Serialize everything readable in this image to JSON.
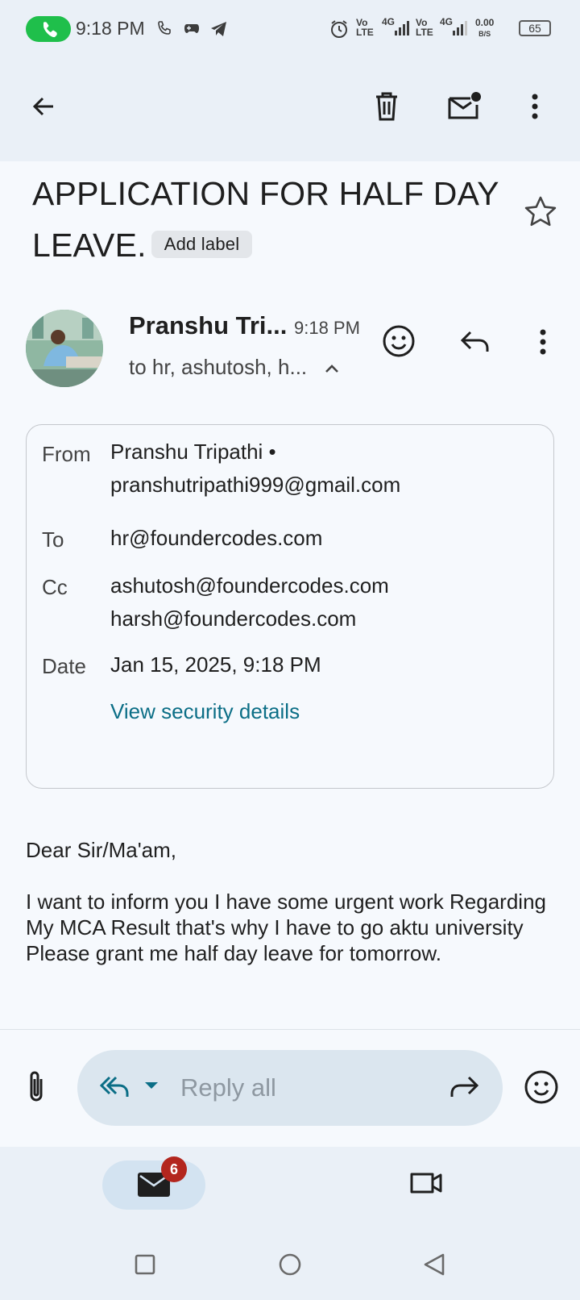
{
  "status_bar": {
    "time": "9:18 PM",
    "net_speed": "0.00",
    "net_unit": "B/S",
    "battery": "65",
    "sig1": "Vo LTE",
    "sig2": "4G"
  },
  "email": {
    "subject": "APPLICATION FOR HALF DAY LEAVE.",
    "add_label": "Add label",
    "sender_short": "Pranshu Tri...",
    "time": "9:18 PM",
    "recipients_short": "to hr, ashutosh, h...",
    "details": {
      "from_label": "From",
      "from_name": "Pranshu Tripathi •",
      "from_email": "pranshutripathi999@gmail.com",
      "to_label": "To",
      "to_value": "hr@foundercodes.com",
      "cc_label": "Cc",
      "cc_values": [
        "ashutosh@foundercodes.com",
        "harsh@foundercodes.com"
      ],
      "date_label": "Date",
      "date_value": "Jan 15, 2025, 9:18 PM",
      "security_link": "View security details"
    },
    "body": {
      "greeting": "Dear Sir/Ma'am,",
      "text": "I want to inform you I have some urgent work Regarding My MCA Result that's why I have to go aktu university Please grant me half day leave for tomorrow."
    }
  },
  "reply_bar": {
    "placeholder": "Reply all"
  },
  "bottom_nav": {
    "mail_badge": "6"
  }
}
